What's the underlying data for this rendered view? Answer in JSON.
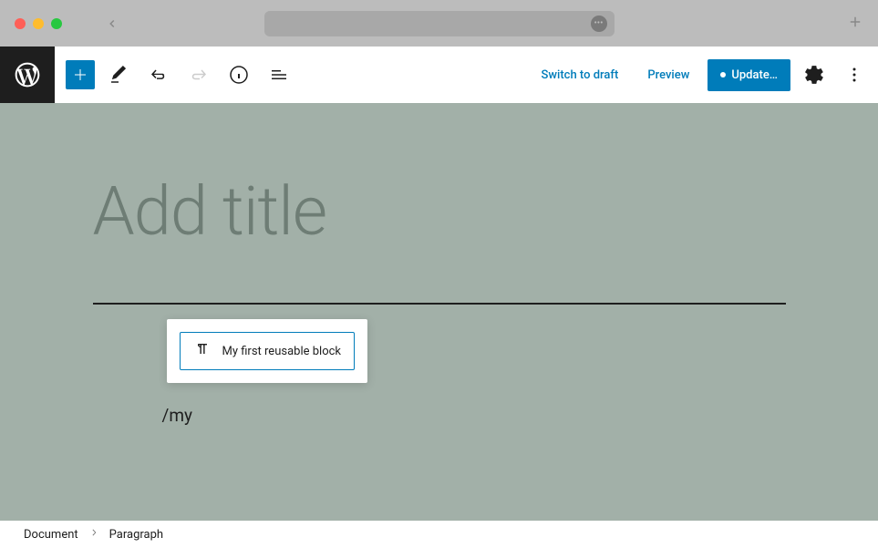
{
  "titlebar": {
    "url_icon_text": "•••"
  },
  "toolbar": {
    "switch_draft_label": "Switch to draft",
    "preview_label": "Preview",
    "update_label": "Update…"
  },
  "editor": {
    "title_placeholder": "Add title",
    "slash_text": "/my",
    "autocomplete": {
      "items": [
        {
          "label": "My first reusable block",
          "icon": "paragraph-icon"
        }
      ]
    }
  },
  "breadcrumb": {
    "root": "Document",
    "current": "Paragraph"
  }
}
